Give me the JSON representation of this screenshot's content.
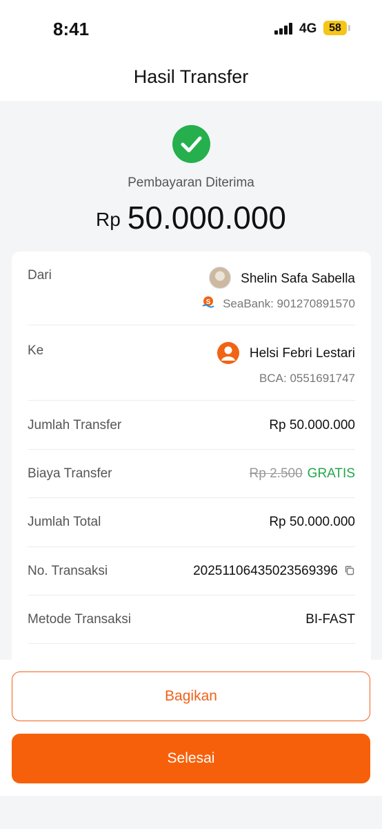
{
  "status_bar": {
    "time": "8:41",
    "network": "4G",
    "battery": "58"
  },
  "header": {
    "title": "Hasil Transfer"
  },
  "result": {
    "status": "Pembayaran Diterima",
    "currency": "Rp",
    "amount": "50.000.000"
  },
  "details": {
    "from": {
      "label": "Dari",
      "name": "Shelin Safa Sabella",
      "account": "SeaBank: 901270891570"
    },
    "to": {
      "label": "Ke",
      "name": "Helsi Febri Lestari",
      "account": "BCA: 0551691747"
    },
    "transfer_amount": {
      "label": "Jumlah Transfer",
      "value": "Rp 50.000.000"
    },
    "fee": {
      "label": "Biaya Transfer",
      "original": "Rp 2.500",
      "value": "GRATIS"
    },
    "total": {
      "label": "Jumlah Total",
      "value": "Rp 50.000.000"
    },
    "transaction_no": {
      "label": "No. Transaksi",
      "value": "20251106435023569396"
    },
    "method": {
      "label": "Metode Transaksi",
      "value": "BI-FAST"
    }
  },
  "actions": {
    "share_label": "Bagikan",
    "done_label": "Selesai"
  },
  "colors": {
    "accent": "#f7600a",
    "success": "#25b04d"
  }
}
